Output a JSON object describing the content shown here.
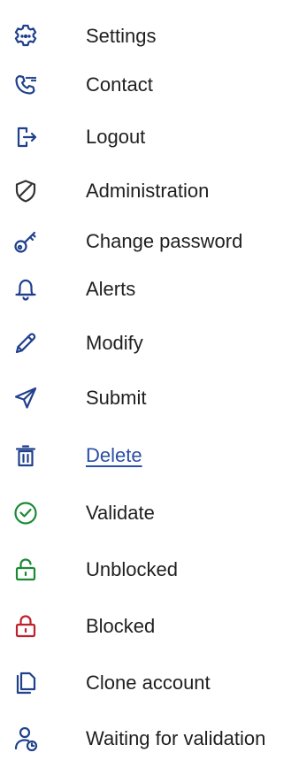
{
  "menu": {
    "items": [
      {
        "label": "Settings",
        "icon": "gear-icon",
        "color": "#20408c"
      },
      {
        "label": "Contact",
        "icon": "phone-icon",
        "color": "#20408c"
      },
      {
        "label": "Logout",
        "icon": "logout-icon",
        "color": "#20408c"
      },
      {
        "label": "Administration",
        "icon": "shield-icon",
        "color": "#333333"
      },
      {
        "label": "Change password",
        "icon": "key-icon",
        "color": "#20408c"
      },
      {
        "label": "Alerts",
        "icon": "bell-icon",
        "color": "#20408c"
      },
      {
        "label": "Modify",
        "icon": "pencil-icon",
        "color": "#20408c"
      },
      {
        "label": "Submit",
        "icon": "send-icon",
        "color": "#20408c"
      },
      {
        "label": "Delete",
        "icon": "trash-icon",
        "color": "#20408c"
      },
      {
        "label": "Validate",
        "icon": "check-circle-icon",
        "color": "#1a8a34"
      },
      {
        "label": "Unblocked",
        "icon": "unlock-icon",
        "color": "#1a8a34"
      },
      {
        "label": "Blocked",
        "icon": "lock-icon",
        "color": "#c0202a"
      },
      {
        "label": "Clone account",
        "icon": "copy-icon",
        "color": "#20408c"
      },
      {
        "label": "Waiting for validation",
        "icon": "user-clock-icon",
        "color": "#20408c"
      }
    ]
  }
}
